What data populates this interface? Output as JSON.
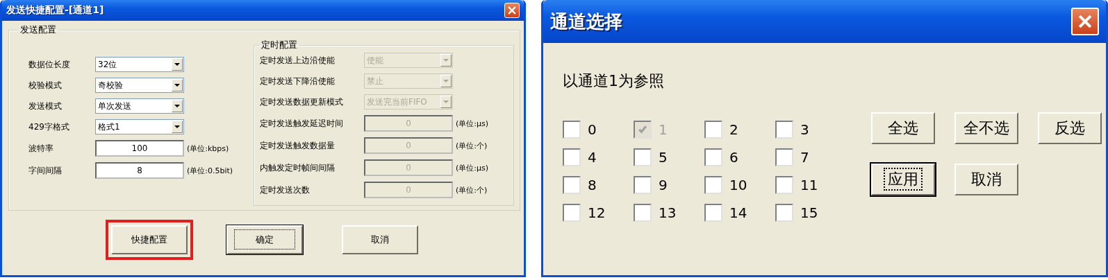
{
  "send_config_dialog": {
    "title": "发送快捷配置-[通道1]",
    "send_group": {
      "legend": "发送配置",
      "rows": [
        {
          "kind": "combo",
          "label": "数据位长度",
          "value": "32位",
          "disabled": false
        },
        {
          "kind": "combo",
          "label": "校验模式",
          "value": "奇校验",
          "disabled": false
        },
        {
          "kind": "combo",
          "label": "发送模式",
          "value": "单次发送",
          "disabled": false
        },
        {
          "kind": "combo",
          "label": "429字格式",
          "value": "格式1",
          "disabled": false
        },
        {
          "kind": "input",
          "label": "波特率",
          "value": "100",
          "unit": "(单位:kbps)",
          "disabled": false
        },
        {
          "kind": "input",
          "label": "字间间隔",
          "value": "8",
          "unit": "(单位:0.5bit)",
          "disabled": false
        }
      ]
    },
    "timer_group": {
      "legend": "定时配置",
      "rows": [
        {
          "kind": "combo",
          "label": "定时发送上边沿使能",
          "value": "使能",
          "disabled": true
        },
        {
          "kind": "combo",
          "label": "定时发送下降沿使能",
          "value": "禁止",
          "disabled": true
        },
        {
          "kind": "combo",
          "label": "定时发送数据更新模式",
          "value": "发送完当前FIFO",
          "disabled": true
        },
        {
          "kind": "input",
          "label": "定时发送触发延迟时间",
          "value": "0",
          "unit": "(单位:μs)",
          "disabled": true
        },
        {
          "kind": "input",
          "label": "定时发送触发数据量",
          "value": "0",
          "unit": "(单位:个)",
          "disabled": true
        },
        {
          "kind": "input",
          "label": "内触发定时帧间间隔",
          "value": "0",
          "unit": "(单位:μs)",
          "disabled": true
        },
        {
          "kind": "input",
          "label": "定时发送次数",
          "value": "0",
          "unit": "(单位:个)",
          "disabled": true
        }
      ]
    },
    "buttons": [
      {
        "label": "快捷配置",
        "focused": false,
        "highlighted": true
      },
      {
        "label": "确定",
        "focused": true,
        "highlighted": false
      },
      {
        "label": "取消",
        "focused": false,
        "highlighted": false
      }
    ]
  },
  "channel_dialog": {
    "title": "通道选择",
    "reference_label": "以通道1为参照",
    "channels": [
      {
        "label": "0",
        "checked": false,
        "disabled": false
      },
      {
        "label": "1",
        "checked": true,
        "disabled": true
      },
      {
        "label": "2",
        "checked": false,
        "disabled": false
      },
      {
        "label": "3",
        "checked": false,
        "disabled": false
      },
      {
        "label": "4",
        "checked": false,
        "disabled": false
      },
      {
        "label": "5",
        "checked": false,
        "disabled": false
      },
      {
        "label": "6",
        "checked": false,
        "disabled": false
      },
      {
        "label": "7",
        "checked": false,
        "disabled": false
      },
      {
        "label": "8",
        "checked": false,
        "disabled": false
      },
      {
        "label": "9",
        "checked": false,
        "disabled": false
      },
      {
        "label": "10",
        "checked": false,
        "disabled": false
      },
      {
        "label": "11",
        "checked": false,
        "disabled": false
      },
      {
        "label": "12",
        "checked": false,
        "disabled": false
      },
      {
        "label": "13",
        "checked": false,
        "disabled": false
      },
      {
        "label": "14",
        "checked": false,
        "disabled": false
      },
      {
        "label": "15",
        "checked": false,
        "disabled": false
      }
    ],
    "buttons": [
      {
        "label": "全选",
        "focused": false
      },
      {
        "label": "全不选",
        "focused": false
      },
      {
        "label": "反选",
        "focused": false
      },
      {
        "label": "应用",
        "focused": true
      },
      {
        "label": "取消",
        "focused": false
      }
    ]
  }
}
